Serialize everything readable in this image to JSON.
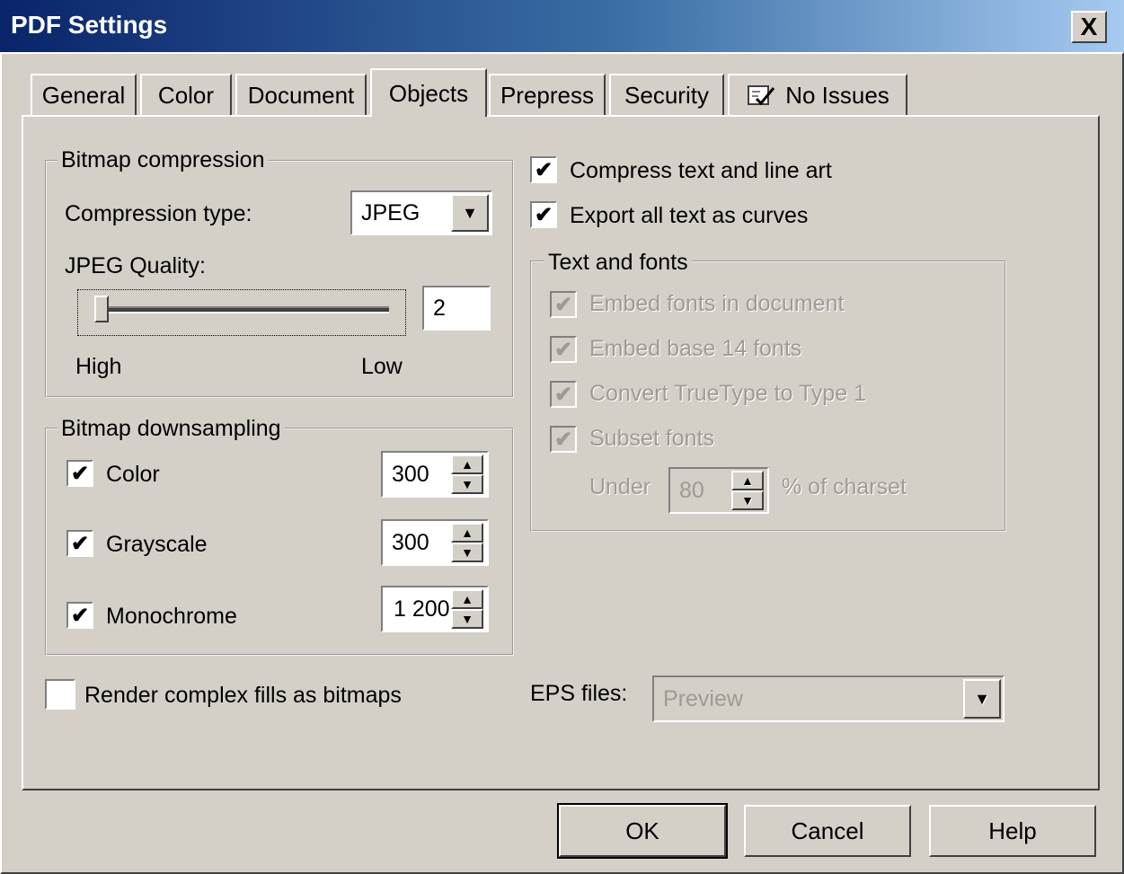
{
  "window": {
    "title": "PDF Settings",
    "close_label": "X"
  },
  "tabs": [
    {
      "label": "General"
    },
    {
      "label": "Color"
    },
    {
      "label": "Document"
    },
    {
      "label": "Objects",
      "active": true
    },
    {
      "label": "Prepress"
    },
    {
      "label": "Security"
    },
    {
      "label": "No Issues",
      "icon": "checklist-icon"
    }
  ],
  "bitmap_compression": {
    "title": "Bitmap compression",
    "compression_type_label": "Compression type:",
    "compression_type_value": "JPEG",
    "jpeg_quality_label": "JPEG Quality:",
    "jpeg_quality_value": "2",
    "slider_level": 0.02,
    "high_label": "High",
    "low_label": "Low"
  },
  "bitmap_downsampling": {
    "title": "Bitmap downsampling",
    "rows": [
      {
        "label": "Color",
        "checked": true,
        "value": "300"
      },
      {
        "label": "Grayscale",
        "checked": true,
        "value": "300"
      },
      {
        "label": "Monochrome",
        "checked": true,
        "value": "1 200"
      }
    ]
  },
  "render_complex_fills": {
    "label": "Render complex fills as bitmaps",
    "checked": false
  },
  "right": {
    "compress_text": {
      "label": "Compress text and line art",
      "checked": true
    },
    "export_text_curves": {
      "label": "Export all text as curves",
      "checked": true
    },
    "text_fonts": {
      "title": "Text and fonts",
      "options": [
        {
          "label": "Embed fonts in document",
          "checked": true
        },
        {
          "label": "Embed base 14 fonts",
          "checked": true
        },
        {
          "label": "Convert TrueType to Type 1",
          "checked": true
        },
        {
          "label": "Subset fonts",
          "checked": true
        }
      ],
      "under_label": "Under",
      "under_value": "80",
      "charset_label": "% of charset"
    },
    "eps_files": {
      "label": "EPS files:",
      "value": "Preview"
    }
  },
  "buttons": {
    "ok": "OK",
    "cancel": "Cancel",
    "help": "Help"
  },
  "glyphs": {
    "check": "✔",
    "spin_up": "▲",
    "spin_down": "▼",
    "dropdown": "▼"
  }
}
